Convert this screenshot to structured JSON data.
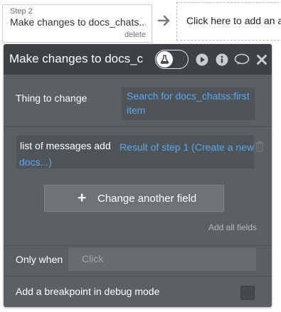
{
  "workflow": {
    "step_num": "Step 2",
    "step_name": "Make changes to docs_chats...",
    "step_delete": "delete",
    "add_action": "Click here to add an action"
  },
  "panel": {
    "title": "Make changes to docs_c",
    "thing_label": "Thing to change",
    "thing_value": "Search for docs_chatss:first item",
    "field_label": "list of messages add",
    "field_value": "Result of step 1 (Create a new docs...)",
    "change_button": "Change another field",
    "add_all": "Add all fields",
    "only_when_label": "Only when",
    "only_when_placeholder": "Click",
    "breakpoint_label": "Add a breakpoint in debug mode"
  },
  "colors": {
    "header_bg": "#3c4246",
    "panel_bg": "#5a6064",
    "dynamic_text": "#5aa8f0"
  },
  "icons": [
    "flask-icon",
    "play-icon",
    "info-icon",
    "comment-icon",
    "close-icon",
    "trash-icon",
    "arrow-right-icon"
  ]
}
